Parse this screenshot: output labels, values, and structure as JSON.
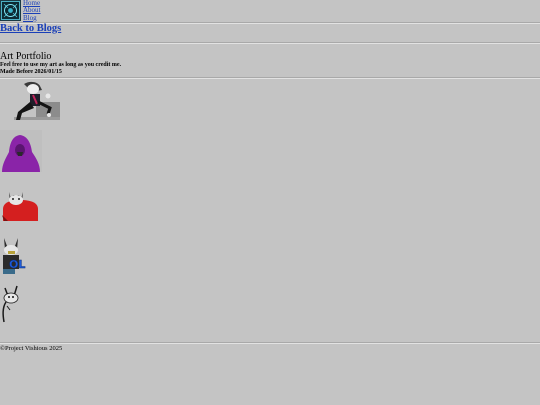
{
  "nav": {
    "items": [
      {
        "label": "Home"
      },
      {
        "label": "About"
      },
      {
        "label": "Blog"
      }
    ]
  },
  "back_link": "Back to Blogs",
  "page": {
    "title": "Art Portfolio",
    "credit_note": "Feel free to use my art as long as you credit me.",
    "made_before": "Made Before 2026/01/15"
  },
  "gallery": [
    {
      "name": "seated-character-art"
    },
    {
      "name": "purple-hooded-character-art"
    },
    {
      "name": "red-shirt-cat-character-art"
    },
    {
      "name": "lol-cat-character-art"
    },
    {
      "name": "cat-sketch-art"
    }
  ],
  "footer": {
    "copyright": "©Project Vishious 2025"
  },
  "colors": {
    "background": "#c4c4c4",
    "link": "#1a3fb8",
    "rule": "#a9a9a9"
  }
}
